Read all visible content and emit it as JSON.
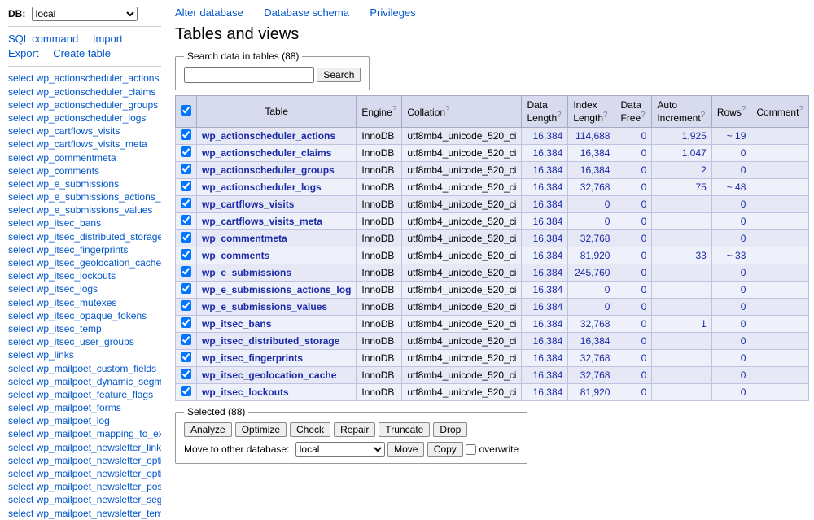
{
  "sidebar": {
    "db_label": "DB:",
    "db_value": "local",
    "links": {
      "sql": "SQL command",
      "import": "Import",
      "export": "Export",
      "create": "Create table"
    },
    "tables": [
      "select wp_actionscheduler_actions",
      "select wp_actionscheduler_claims",
      "select wp_actionscheduler_groups",
      "select wp_actionscheduler_logs",
      "select wp_cartflows_visits",
      "select wp_cartflows_visits_meta",
      "select wp_commentmeta",
      "select wp_comments",
      "select wp_e_submissions",
      "select wp_e_submissions_actions_lo",
      "select wp_e_submissions_values",
      "select wp_itsec_bans",
      "select wp_itsec_distributed_storage",
      "select wp_itsec_fingerprints",
      "select wp_itsec_geolocation_cache",
      "select wp_itsec_lockouts",
      "select wp_itsec_logs",
      "select wp_itsec_mutexes",
      "select wp_itsec_opaque_tokens",
      "select wp_itsec_temp",
      "select wp_itsec_user_groups",
      "select wp_links",
      "select wp_mailpoet_custom_fields",
      "select wp_mailpoet_dynamic_segme",
      "select wp_mailpoet_feature_flags",
      "select wp_mailpoet_forms",
      "select wp_mailpoet_log",
      "select wp_mailpoet_mapping_to_ex",
      "select wp_mailpoet_newsletter_link",
      "select wp_mailpoet_newsletter_opti",
      "select wp_mailpoet_newsletter_opti",
      "select wp_mailpoet_newsletter_pos",
      "select wp_mailpoet_newsletter_seg",
      "select wp_mailpoet_newsletter_tem"
    ]
  },
  "topnav": {
    "alter": "Alter database",
    "schema": "Database schema",
    "priv": "Privileges"
  },
  "page_title": "Tables and views",
  "search": {
    "legend": "Search data in tables (88)",
    "button": "Search",
    "value": ""
  },
  "columns": {
    "table": "Table",
    "engine": "Engine",
    "collation": "Collation",
    "data_length": "Data Length",
    "index_length": "Index Length",
    "data_free": "Data Free",
    "auto_inc": "Auto Increment",
    "rows": "Rows",
    "comment": "Comment"
  },
  "rows": [
    {
      "name": "wp_actionscheduler_actions",
      "engine": "InnoDB",
      "collation": "utf8mb4_unicode_520_ci",
      "data": "16,384",
      "index": "114,688",
      "free": "0",
      "auto": "1,925",
      "rows": "~ 19"
    },
    {
      "name": "wp_actionscheduler_claims",
      "engine": "InnoDB",
      "collation": "utf8mb4_unicode_520_ci",
      "data": "16,384",
      "index": "16,384",
      "free": "0",
      "auto": "1,047",
      "rows": "0"
    },
    {
      "name": "wp_actionscheduler_groups",
      "engine": "InnoDB",
      "collation": "utf8mb4_unicode_520_ci",
      "data": "16,384",
      "index": "16,384",
      "free": "0",
      "auto": "2",
      "rows": "0"
    },
    {
      "name": "wp_actionscheduler_logs",
      "engine": "InnoDB",
      "collation": "utf8mb4_unicode_520_ci",
      "data": "16,384",
      "index": "32,768",
      "free": "0",
      "auto": "75",
      "rows": "~ 48"
    },
    {
      "name": "wp_cartflows_visits",
      "engine": "InnoDB",
      "collation": "utf8mb4_unicode_520_ci",
      "data": "16,384",
      "index": "0",
      "free": "0",
      "auto": "",
      "rows": "0"
    },
    {
      "name": "wp_cartflows_visits_meta",
      "engine": "InnoDB",
      "collation": "utf8mb4_unicode_520_ci",
      "data": "16,384",
      "index": "0",
      "free": "0",
      "auto": "",
      "rows": "0"
    },
    {
      "name": "wp_commentmeta",
      "engine": "InnoDB",
      "collation": "utf8mb4_unicode_520_ci",
      "data": "16,384",
      "index": "32,768",
      "free": "0",
      "auto": "",
      "rows": "0"
    },
    {
      "name": "wp_comments",
      "engine": "InnoDB",
      "collation": "utf8mb4_unicode_520_ci",
      "data": "16,384",
      "index": "81,920",
      "free": "0",
      "auto": "33",
      "rows": "~ 33"
    },
    {
      "name": "wp_e_submissions",
      "engine": "InnoDB",
      "collation": "utf8mb4_unicode_520_ci",
      "data": "16,384",
      "index": "245,760",
      "free": "0",
      "auto": "",
      "rows": "0"
    },
    {
      "name": "wp_e_submissions_actions_log",
      "engine": "InnoDB",
      "collation": "utf8mb4_unicode_520_ci",
      "data": "16,384",
      "index": "0",
      "free": "0",
      "auto": "",
      "rows": "0"
    },
    {
      "name": "wp_e_submissions_values",
      "engine": "InnoDB",
      "collation": "utf8mb4_unicode_520_ci",
      "data": "16,384",
      "index": "0",
      "free": "0",
      "auto": "",
      "rows": "0"
    },
    {
      "name": "wp_itsec_bans",
      "engine": "InnoDB",
      "collation": "utf8mb4_unicode_520_ci",
      "data": "16,384",
      "index": "32,768",
      "free": "0",
      "auto": "1",
      "rows": "0"
    },
    {
      "name": "wp_itsec_distributed_storage",
      "engine": "InnoDB",
      "collation": "utf8mb4_unicode_520_ci",
      "data": "16,384",
      "index": "16,384",
      "free": "0",
      "auto": "",
      "rows": "0"
    },
    {
      "name": "wp_itsec_fingerprints",
      "engine": "InnoDB",
      "collation": "utf8mb4_unicode_520_ci",
      "data": "16,384",
      "index": "32,768",
      "free": "0",
      "auto": "",
      "rows": "0"
    },
    {
      "name": "wp_itsec_geolocation_cache",
      "engine": "InnoDB",
      "collation": "utf8mb4_unicode_520_ci",
      "data": "16,384",
      "index": "32,768",
      "free": "0",
      "auto": "",
      "rows": "0"
    },
    {
      "name": "wp_itsec_lockouts",
      "engine": "InnoDB",
      "collation": "utf8mb4_unicode_520_ci",
      "data": "16,384",
      "index": "81,920",
      "free": "0",
      "auto": "",
      "rows": "0"
    }
  ],
  "selected": {
    "legend": "Selected (88)",
    "buttons": [
      "Analyze",
      "Optimize",
      "Check",
      "Repair",
      "Truncate",
      "Drop"
    ],
    "move_label": "Move to other database:",
    "db_value": "local",
    "move": "Move",
    "copy": "Copy",
    "overwrite": "overwrite"
  }
}
